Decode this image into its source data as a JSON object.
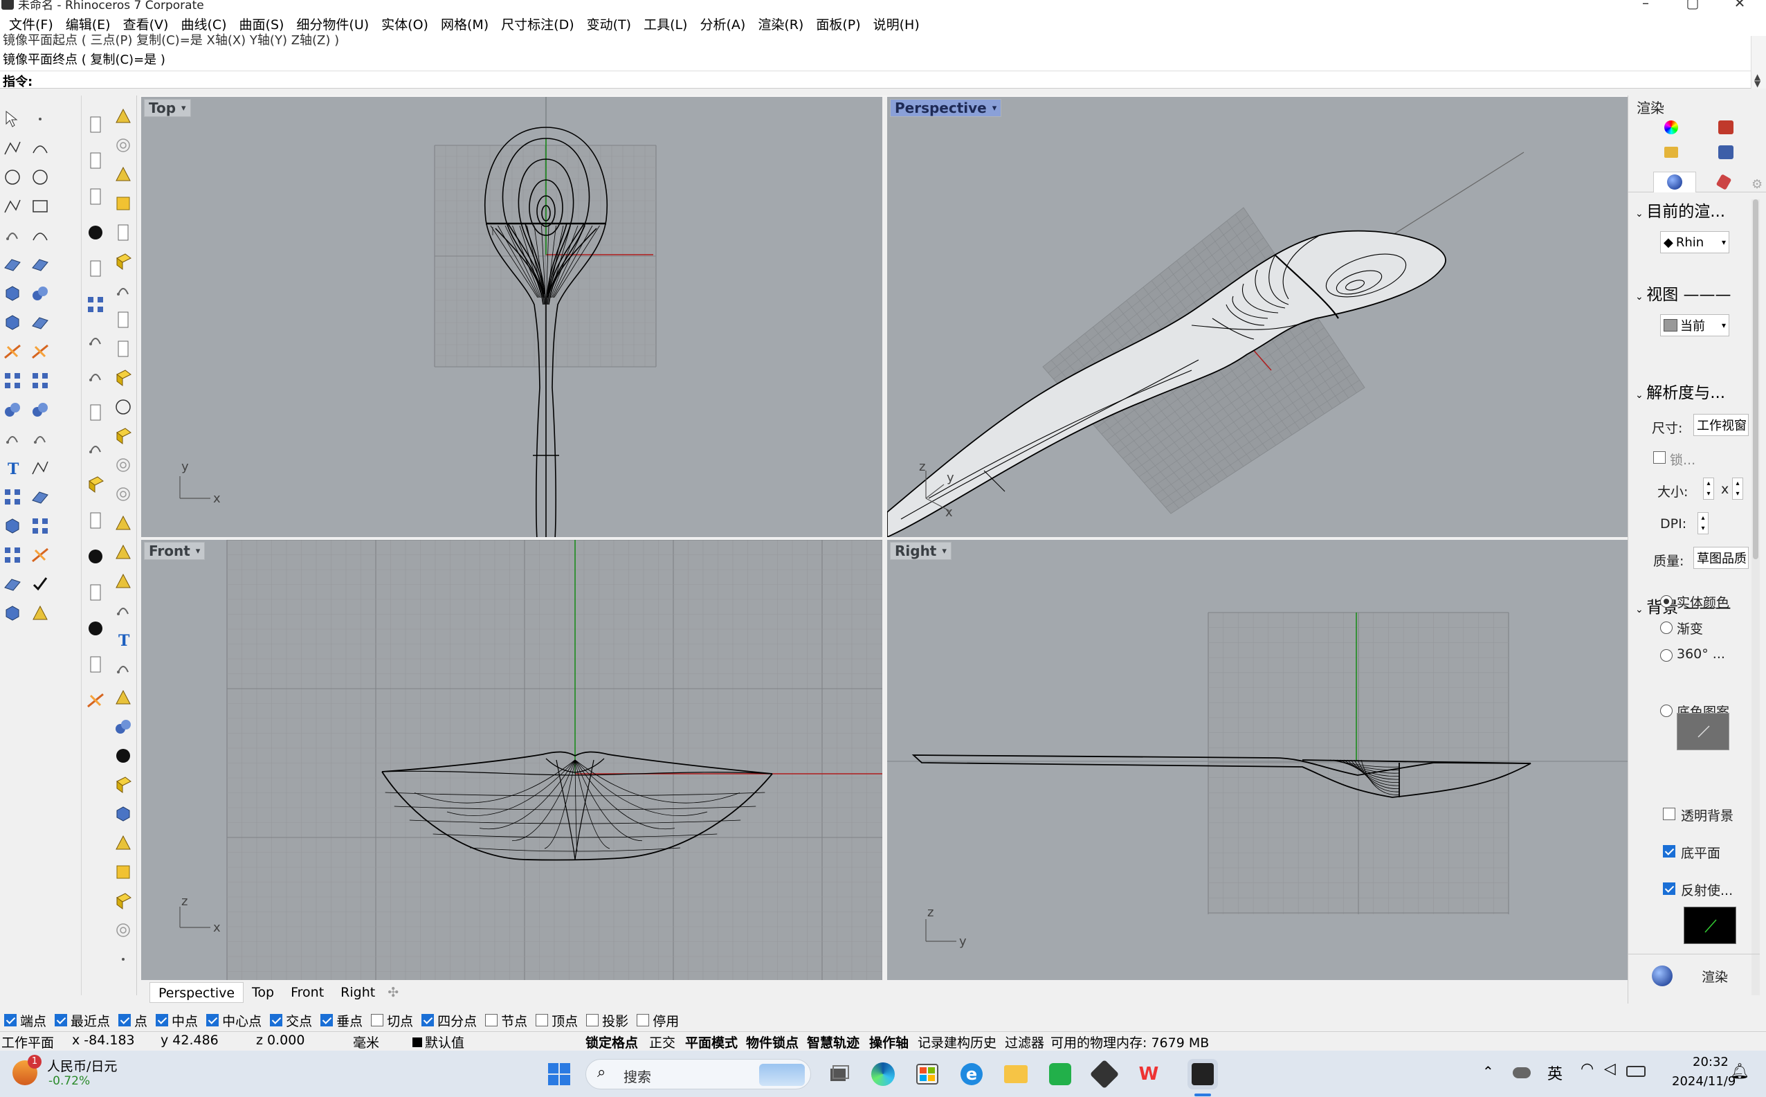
{
  "window": {
    "title": "未命名 - Rhinoceros 7 Corporate",
    "min": "–",
    "max": "▢",
    "close": "✕"
  },
  "menu": [
    "文件(F)",
    "编辑(E)",
    "查看(V)",
    "曲线(C)",
    "曲面(S)",
    "细分物件(U)",
    "实体(O)",
    "网格(M)",
    "尺寸标注(D)",
    "变动(T)",
    "工具(L)",
    "分析(A)",
    "渲染(R)",
    "面板(P)",
    "说明(H)"
  ],
  "command": {
    "history_line1": "镜像平面起点 ( 三点(P) 复制(C)=是 X轴(X) Y轴(Y) Z轴(Z) )",
    "history_line2": "镜像平面终点 ( 复制(C)=是 )",
    "prompt_label": "指令:",
    "input_value": ""
  },
  "viewports": {
    "top": {
      "label": "Top"
    },
    "perspective": {
      "label": "Perspective"
    },
    "front": {
      "label": "Front"
    },
    "right": {
      "label": "Right"
    },
    "axis": {
      "x": "x",
      "y": "y",
      "z": "z"
    }
  },
  "viewport_tabs": [
    "Perspective",
    "Top",
    "Front",
    "Right"
  ],
  "viewport_tabs_add": "✣",
  "osnap": [
    {
      "label": "端点",
      "checked": true
    },
    {
      "label": "最近点",
      "checked": true
    },
    {
      "label": "点",
      "checked": true
    },
    {
      "label": "中点",
      "checked": true
    },
    {
      "label": "中心点",
      "checked": true
    },
    {
      "label": "交点",
      "checked": true
    },
    {
      "label": "垂点",
      "checked": true
    },
    {
      "label": "切点",
      "checked": false
    },
    {
      "label": "四分点",
      "checked": true
    },
    {
      "label": "节点",
      "checked": false
    },
    {
      "label": "顶点",
      "checked": false
    },
    {
      "label": "投影",
      "checked": false
    },
    {
      "label": "停用",
      "checked": false
    }
  ],
  "status": {
    "cplane": "工作平面",
    "x": "x -84.183",
    "y": "y 42.486",
    "z": "z 0.000",
    "unit": "毫米",
    "layer": "默认值",
    "grid_snap": "锁定格点",
    "ortho": "正交",
    "planar": "平面模式",
    "osnap": "物件锁点",
    "smarttrack": "智慧轨迹",
    "gumball": "操作轴",
    "history": "记录建构历史",
    "filter": "过滤器",
    "memory": "可用的物理内存: 7679 MB"
  },
  "right_panel": {
    "title": "渲染",
    "section_current": "目前的渲...",
    "renderer": "Rhin",
    "section_view": "视图",
    "view_value": "当前",
    "section_resolution": "解析度与...",
    "size_label": "尺寸:",
    "size_value": "工作视窗",
    "lock_label": "锁...",
    "dims_label": "大小:",
    "times": "x",
    "dpi_label": "DPI:",
    "quality_label": "质量:",
    "quality_value": "草图品质",
    "section_background": "背景",
    "bg_options": [
      {
        "label": "实体颜色",
        "selected": true
      },
      {
        "label": "渐变",
        "selected": false
      },
      {
        "label": "360° ...",
        "selected": false
      },
      {
        "label": "底色图案",
        "selected": false
      }
    ],
    "transparent_bg": {
      "label": "透明背景",
      "checked": false
    },
    "ground_plane": {
      "label": "底平面",
      "checked": true
    },
    "reflective": {
      "label": "反射使...",
      "checked": true
    },
    "render_button": "渲染"
  },
  "taskbar": {
    "weather_label": "人民币/日元",
    "weather_value": "-0.72%",
    "weather_badge": "1",
    "search_placeholder": "搜索",
    "ime": "英",
    "time": "20:32",
    "date": "2024/11/9"
  },
  "colors": {
    "viewport_bg": "#a3a8ad",
    "grid_minor": "#96999d",
    "grid_major": "#7f8286",
    "axis_x": "#b01c1c",
    "axis_y": "#138a13",
    "active_tab": "#8aa0d8",
    "accent": "#1a6fd6"
  }
}
